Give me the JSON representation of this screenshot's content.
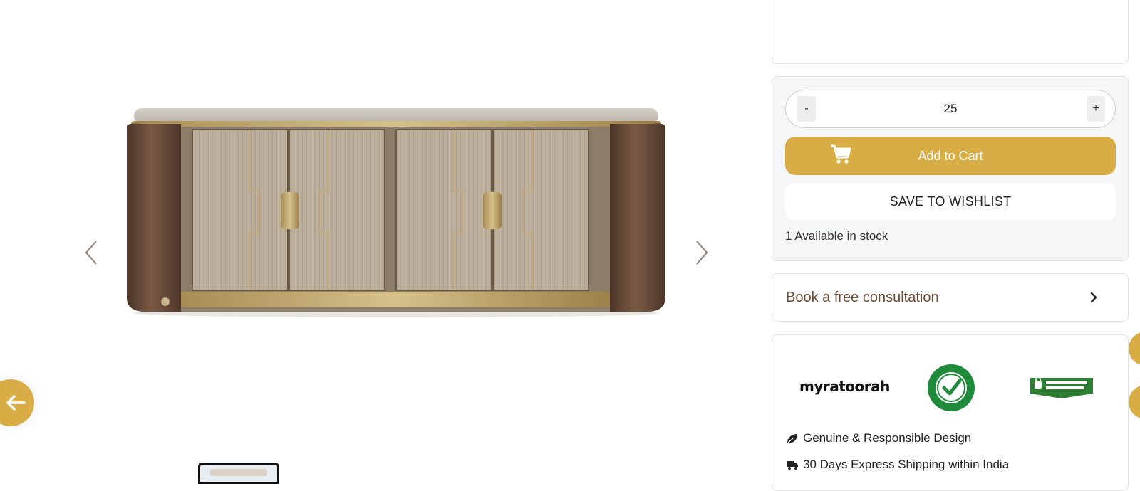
{
  "gallery": {
    "image_alt": "Sideboard with wooden end panels and four textured doors",
    "prev_icon": "chevron-left-icon",
    "next_icon": "chevron-right-icon",
    "back_icon": "arrow-left-icon"
  },
  "purchase": {
    "qty_minus": "-",
    "qty_value": "25",
    "qty_plus": "+",
    "add_to_cart": "Add to Cart",
    "save_to_wishlist": "SAVE TO WISHLIST",
    "stock_text": "1 Available in stock"
  },
  "consultation": {
    "label": "Book a free consultation"
  },
  "trust": {
    "brand_logo_text": "myratoorah",
    "features": [
      "Genuine & Responsible Design",
      "30 Days Express Shipping within India"
    ]
  },
  "colors": {
    "accent": "#d9ad45",
    "consult_text": "#6a4a36",
    "quality_green": "#1f8a3a"
  }
}
